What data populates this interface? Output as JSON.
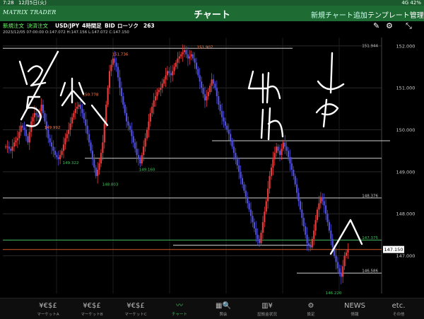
{
  "status_bar": {
    "time": "7:28",
    "date": "12月5日(火)",
    "right": "4G 42%"
  },
  "header": {
    "logo": "MATRIX TRADER",
    "title": "チャート",
    "add_chart": "新規チャート追加",
    "template": "テンプレート管理"
  },
  "toolbar": {
    "new_order": "新規注文",
    "settle_order": "決済注文",
    "symbol": "USD/JPY",
    "timeframe": "4時間足",
    "side": "BID",
    "chart_type": "ローソク",
    "count": "263",
    "edit_icon": "pencil-icon",
    "settings_icon": "gear-icon"
  },
  "ohlc": "2023/12/05 07:00:00   O:147.072   H:147.156   L:147.072   C:147.150",
  "chart_data": {
    "type": "candlestick",
    "symbol": "USD/JPY",
    "timeframe": "4時間足",
    "ylim": [
      146.1,
      152.2
    ],
    "y_ticks": [
      152.0,
      151.0,
      150.0,
      149.0,
      148.0,
      147.0
    ],
    "y_tick_labels": [
      "152.000",
      "151.000",
      "150.000",
      "149.000",
      "148.000",
      "147.000"
    ],
    "right_labels": [
      {
        "value": 151.944,
        "text": "151.944",
        "color": "#cccccc"
      },
      {
        "value": 148.376,
        "text": "148.376",
        "color": "#cccccc"
      },
      {
        "value": 147.375,
        "text": "147.375",
        "color": "#3fbf5f"
      },
      {
        "value": 147.15,
        "text": "147.150",
        "color": "#ffffff"
      },
      {
        "value": 146.586,
        "text": "146.586",
        "color": "#cccccc"
      }
    ],
    "annotations": [
      {
        "text": "151.736",
        "value": 151.736,
        "color": "#ff7f4f"
      },
      {
        "text": "151.907",
        "value": 151.907,
        "color": "#ff7f4f"
      },
      {
        "text": "150.778",
        "value": 150.778,
        "color": "#ff7f4f"
      },
      {
        "text": "149.992",
        "value": 149.992,
        "color": "#ff7f4f"
      },
      {
        "text": "149.322",
        "value": 149.322,
        "color": "#3fbf5f"
      },
      {
        "text": "149.160",
        "value": 149.16,
        "color": "#3fbf5f"
      },
      {
        "text": "148.803",
        "value": 148.803,
        "color": "#3fbf5f"
      },
      {
        "text": "146.220",
        "value": 146.22,
        "color": "#3fbf5f"
      }
    ],
    "horizontal_lines": [
      151.944,
      149.74,
      149.322,
      148.376,
      147.375,
      147.15,
      146.586
    ],
    "close_path": [
      149.6,
      149.5,
      149.7,
      149.8,
      150.1,
      150.0,
      149.7,
      150.2,
      150.4,
      150.3,
      150.6,
      150.2,
      149.8,
      149.6,
      149.4,
      149.3,
      149.5,
      149.8,
      150.0,
      150.3,
      150.5,
      150.6,
      150.4,
      150.1,
      149.7,
      149.3,
      148.9,
      149.2,
      149.7,
      150.6,
      151.4,
      151.7,
      151.5,
      151.0,
      150.6,
      150.2,
      150.0,
      149.7,
      149.4,
      149.2,
      149.6,
      150.0,
      150.4,
      150.7,
      150.9,
      151.0,
      151.2,
      151.4,
      151.3,
      151.5,
      151.7,
      151.8,
      151.9,
      151.7,
      151.8,
      151.6,
      151.3,
      151.0,
      150.7,
      150.9,
      151.2,
      151.0,
      150.6,
      150.3,
      150.1,
      149.9,
      149.6,
      149.3,
      149.0,
      148.7,
      148.4,
      148.1,
      147.8,
      147.5,
      147.3,
      147.8,
      148.3,
      148.9,
      149.3,
      149.6,
      149.4,
      149.7,
      149.5,
      149.2,
      148.9,
      148.5,
      148.1,
      147.7,
      147.3,
      147.2,
      147.6,
      148.1,
      148.4,
      148.2,
      147.8,
      147.4,
      147.0,
      146.7,
      146.5,
      147.0,
      147.15
    ],
    "color_up": "#e83a3a",
    "color_down": "#4f4fd9"
  },
  "handwriting": {
    "left_note": "12/5 火",
    "right_note": "4h ↓  1h ↑"
  },
  "tabs": [
    {
      "icon": "currency-icon",
      "glyph": "¥€$£",
      "label": "マーケットA"
    },
    {
      "icon": "currency-icon",
      "glyph": "¥€$£",
      "label": "マーケットB"
    },
    {
      "icon": "currency-icon",
      "glyph": "¥€$£",
      "label": "マーケットC"
    },
    {
      "icon": "chart-icon",
      "glyph": "〰",
      "label": "チャート"
    },
    {
      "icon": "search-icon",
      "glyph": "▦🔍",
      "label": "照会"
    },
    {
      "icon": "margin-icon",
      "glyph": "▥¥",
      "label": "証拠金状況"
    },
    {
      "icon": "settings-icon",
      "glyph": "⚙",
      "label": "設定"
    },
    {
      "icon": "news-icon",
      "glyph": "NEWS",
      "label": "情報"
    },
    {
      "icon": "more-icon",
      "glyph": "etc.",
      "label": "その他"
    }
  ],
  "colors": {
    "header": "#1e6b34",
    "accent": "#3fbf5f"
  }
}
